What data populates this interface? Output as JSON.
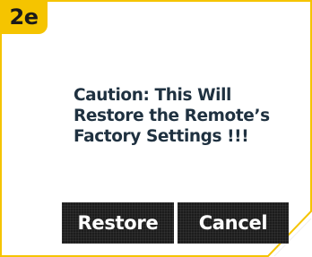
{
  "step_badge": "2e",
  "dialog": {
    "message_lines": [
      "Caution:  This Will",
      "Restore the Remote’s",
      "Factory Settings  !!!"
    ]
  },
  "buttons": {
    "restore_label": "Restore",
    "cancel_label": "Cancel"
  },
  "colors": {
    "badge": "#f5c400",
    "frame": "#f5c400",
    "button_bg": "#1c1c1c",
    "message_text": "#1f3140"
  }
}
